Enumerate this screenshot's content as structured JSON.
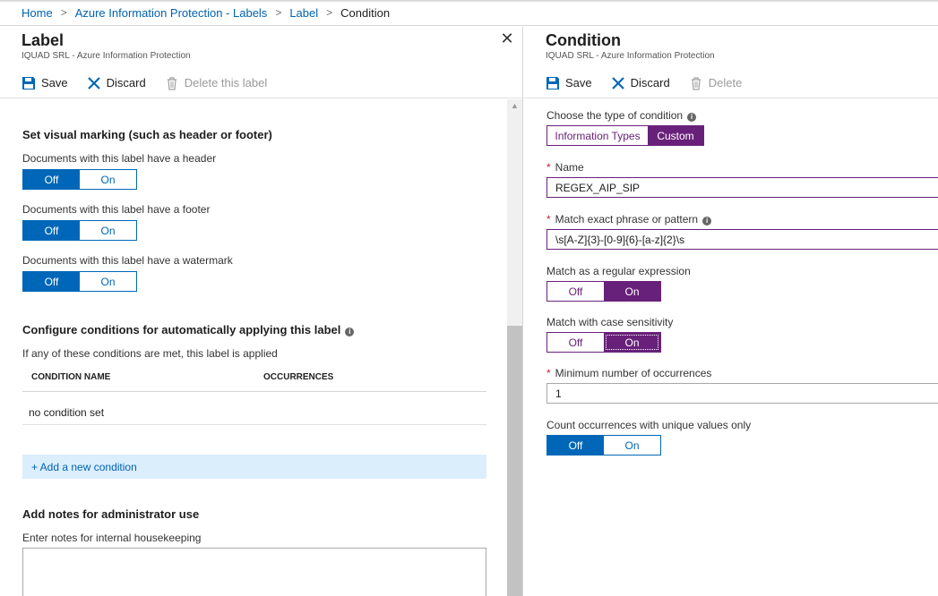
{
  "breadcrumb": [
    {
      "label": "Home"
    },
    {
      "label": "Azure Information Protection - Labels"
    },
    {
      "label": "Label"
    },
    {
      "label": "Condition"
    }
  ],
  "left_blade": {
    "title": "Label",
    "subtitle": "IQUAD SRL - Azure Information Protection",
    "close_glyph": "✕",
    "toolbar": {
      "save": "Save",
      "discard": "Discard",
      "delete": "Delete this label"
    },
    "visual_marking": {
      "title": "Set visual marking (such as header or footer)",
      "header": {
        "label": "Documents with this label have a header",
        "off": "Off",
        "on": "On",
        "selected": "off"
      },
      "footer": {
        "label": "Documents with this label have a footer",
        "off": "Off",
        "on": "On",
        "selected": "off"
      },
      "watermark": {
        "label": "Documents with this label have a watermark",
        "off": "Off",
        "on": "On",
        "selected": "off"
      }
    },
    "conditions": {
      "title": "Configure conditions for automatically applying this label",
      "description": "If any of these conditions are met, this label is applied",
      "columns": [
        "CONDITION NAME",
        "OCCURRENCES"
      ],
      "empty_row": "no condition set",
      "add_link": "+ Add a new condition"
    },
    "notes": {
      "title": "Add notes for administrator use",
      "label": "Enter notes for internal housekeeping",
      "value": ""
    }
  },
  "right_blade": {
    "title": "Condition",
    "subtitle": "IQUAD SRL - Azure Information Protection",
    "toolbar": {
      "save": "Save",
      "discard": "Discard",
      "delete": "Delete"
    },
    "condition_type": {
      "label": "Choose the type of condition",
      "options": [
        "Information Types",
        "Custom"
      ],
      "selected": "Custom"
    },
    "name": {
      "label": "Name",
      "value": "REGEX_AIP_SIP"
    },
    "pattern": {
      "label": "Match exact phrase or pattern",
      "value": "\\s[A-Z]{3}-[0-9]{6}-[a-z]{2}\\s"
    },
    "regex": {
      "label": "Match as a regular expression",
      "off": "Off",
      "on": "On",
      "selected": "on"
    },
    "case_sensitivity": {
      "label": "Match with case sensitivity",
      "off": "Off",
      "on": "On",
      "selected": "on"
    },
    "min_occurrences": {
      "label": "Minimum number of occurrences",
      "value": "1"
    },
    "unique_values": {
      "label": "Count occurrences with unique values only",
      "off": "Off",
      "on": "On",
      "selected": "off"
    }
  },
  "colors": {
    "accent_blue": "#0067b8",
    "accent_purple": "#68217a",
    "link_blue": "#0063b1",
    "required_red": "#c1262d"
  }
}
